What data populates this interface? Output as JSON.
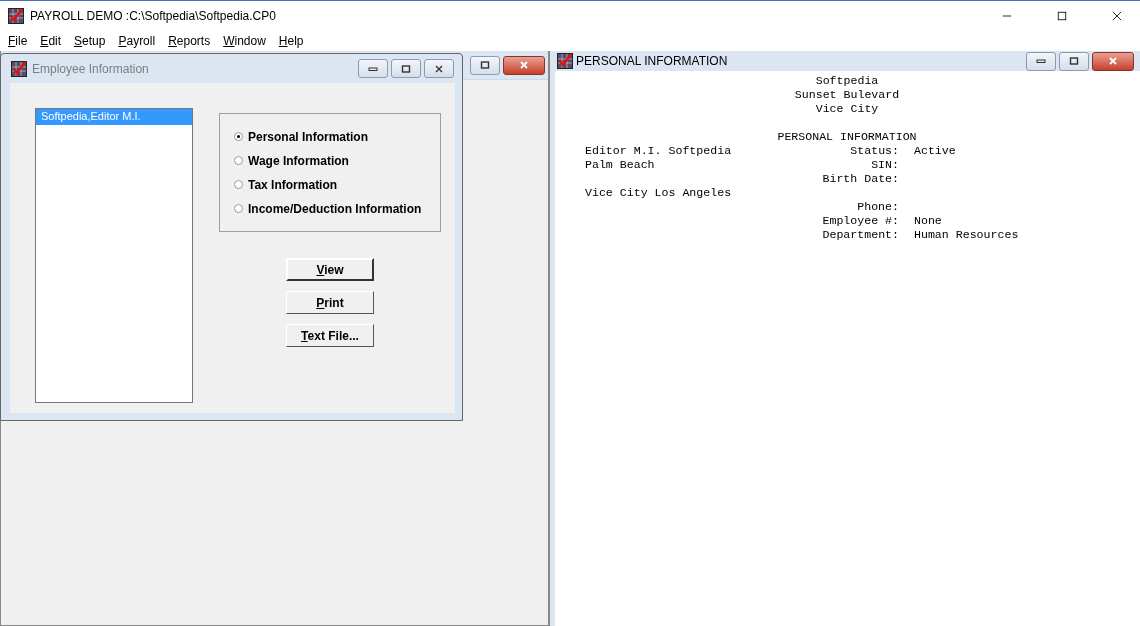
{
  "app": {
    "title": "PAYROLL DEMO :C:\\Softpedia\\Softpedia.CP0"
  },
  "menu": [
    "File",
    "Edit",
    "Setup",
    "Payroll",
    "Reports",
    "Window",
    "Help"
  ],
  "employee_window": {
    "title": "Employee Information",
    "employees": [
      {
        "label": "Softpedia,Editor M.I.",
        "selected": true
      }
    ],
    "options": [
      {
        "label": "Personal Information",
        "selected": true
      },
      {
        "label": "Wage Information",
        "selected": false
      },
      {
        "label": "Tax Information",
        "selected": false
      },
      {
        "label": "Income/Deduction Information",
        "selected": false
      }
    ],
    "buttons": [
      {
        "label": "View",
        "default": true
      },
      {
        "label": "Print",
        "default": false
      },
      {
        "label": "Text File...",
        "default": false
      }
    ]
  },
  "report_window": {
    "title": "PERSONAL INFORMATION",
    "header_lines": [
      "Softpedia",
      "Sunset Bulevard",
      "Vice City"
    ],
    "section_title": "PERSONAL INFORMATION",
    "rows": [
      {
        "left": "Editor M.I. Softpedia",
        "label": "Status:",
        "value": "Active"
      },
      {
        "left": "Palm Beach",
        "label": "SIN:",
        "value": ""
      },
      {
        "left": "",
        "label": "Birth Date:",
        "value": ""
      },
      {
        "left": "Vice City Los Angeles",
        "label": "",
        "value": ""
      },
      {
        "left": "",
        "label": "Phone:",
        "value": ""
      },
      {
        "left": "",
        "label": "Employee #:",
        "value": "None"
      },
      {
        "left": "",
        "label": "Department:",
        "value": "Human Resources"
      }
    ]
  }
}
